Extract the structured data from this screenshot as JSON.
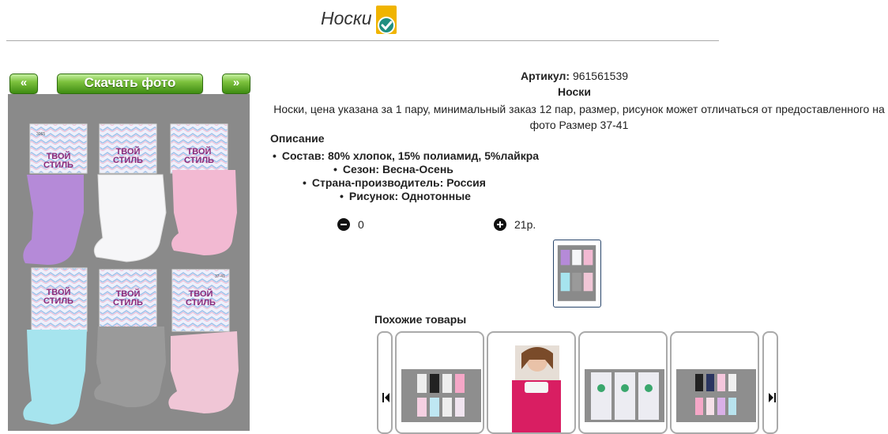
{
  "header": {
    "title": "Носки"
  },
  "gallery": {
    "prev_label": "«",
    "download_label": "Скачать фото",
    "next_label": "»",
    "brand_lines": [
      "ТВОЙ",
      "СТИЛЬ"
    ],
    "pack_code": "3065",
    "pack_size": "37-41"
  },
  "product": {
    "sku_label": "Артикул:",
    "sku_value": "961561539",
    "name": "Носки",
    "description": "Носки, цена указана за 1 пару, минимальный заказ 12 пар, размер, рисунок может отличаться от предоставленного на фото Размер 37-41",
    "description_heading": "Описание",
    "attributes": [
      "Состав: 80% хлопок, 15% полиамид, 5%лайкра",
      "Сезон: Весна-Осень",
      "Страна-производитель: Россия",
      "Рисунок: Однотонные"
    ],
    "quantity": "0",
    "price": "21р."
  },
  "similar": {
    "heading": "Похожие товары"
  },
  "colors": {
    "accent_green": "#5aa321",
    "thumb_border": "#28456b",
    "badge_yellow": "#f0b400",
    "badge_teal": "#1f8f80"
  }
}
